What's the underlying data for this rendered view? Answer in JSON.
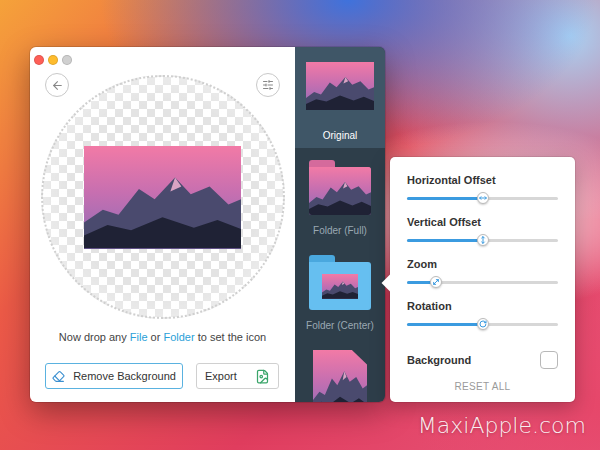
{
  "drop_hint": [
    {
      "text": "Now drop any ",
      "link": false
    },
    {
      "text": "File",
      "link": true
    },
    {
      "text": " or ",
      "link": false
    },
    {
      "text": "Folder",
      "link": true
    },
    {
      "text": " to set the icon",
      "link": false
    }
  ],
  "buttons": [
    {
      "label": "Remove Background",
      "kind": "remove"
    },
    {
      "label": "Export",
      "kind": "export"
    }
  ],
  "styles": [
    {
      "label": "Original",
      "selected": true,
      "kind": "original"
    },
    {
      "label": "Folder (Full)",
      "selected": false,
      "kind": "folder-full"
    },
    {
      "label": "Folder (Center)",
      "selected": false,
      "kind": "folder-center"
    },
    {
      "label": "",
      "selected": false,
      "kind": "document"
    }
  ],
  "settings": {
    "sliders": [
      {
        "label": "Horizontal Offset",
        "level": 0.5,
        "kind": "horizontal"
      },
      {
        "label": "Vertical Offset",
        "level": 0.5,
        "kind": "vertical"
      },
      {
        "label": "Zoom",
        "level": 0.19,
        "kind": "zoom"
      },
      {
        "label": "Rotation",
        "level": 0.5,
        "kind": "rotation"
      }
    ],
    "checkbox": {
      "label": "Background",
      "checked": false
    },
    "reset": "RESET ALL"
  },
  "watermark": "MaxiApple.com"
}
